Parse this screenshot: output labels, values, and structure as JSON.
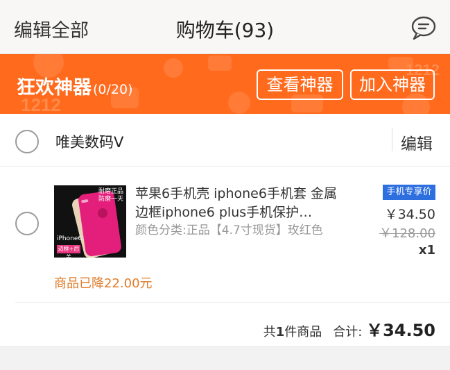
{
  "header": {
    "edit_all": "编辑全部",
    "title": "购物车(93)",
    "message_icon": "chat-bubble-icon"
  },
  "banner": {
    "title": "狂欢神器",
    "count": "(0/20)",
    "view_button": "查看神器",
    "add_button": "加入神器",
    "background_color": "#ff6a1c",
    "decoration_text": "1212"
  },
  "shop": {
    "name": "唯美数码V",
    "edit_label": "编辑"
  },
  "item": {
    "title": "苹果6手机壳 iphone6手机套 金属边框iphone6 plus手机保护…",
    "spec": "颜色分类:正品【4.7寸现货】玫红色",
    "badge": "手机专享价",
    "price": "￥34.50",
    "original_price": "￥128.00",
    "quantity": "x1",
    "price_drop": "商品已降22.00元",
    "image_text": {
      "line1": "耐磨正品",
      "line2": "防磨一天",
      "model": "iPhone6",
      "tag": "边框+后盖"
    }
  },
  "summary": {
    "count_prefix": "共",
    "count": "1",
    "count_suffix": "件商品",
    "total_label": "合计:",
    "total": "￥34.50"
  },
  "colors": {
    "accent_orange": "#ff6a1c",
    "badge_blue": "#2d6fdf",
    "price_drop": "#e07b28"
  }
}
